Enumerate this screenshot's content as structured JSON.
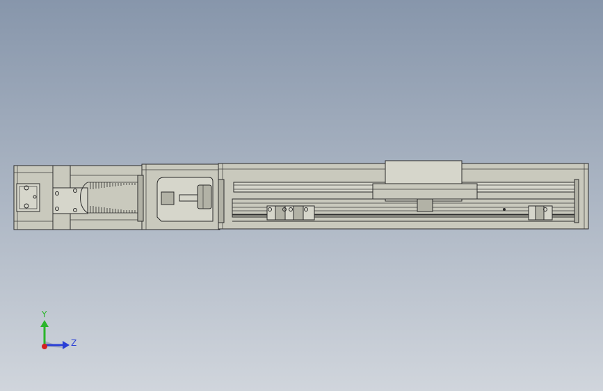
{
  "viewport": {
    "background_top": "#8796ab",
    "background_bottom": "#d0d5dc",
    "model_color": "#c9c9bd",
    "edge_color": "#2a2a2a"
  },
  "triad": {
    "y_label": "Y",
    "z_label": "Z",
    "y_color": "#2bb52b",
    "z_color": "#2a3fd6",
    "x_color": "#d42020"
  }
}
